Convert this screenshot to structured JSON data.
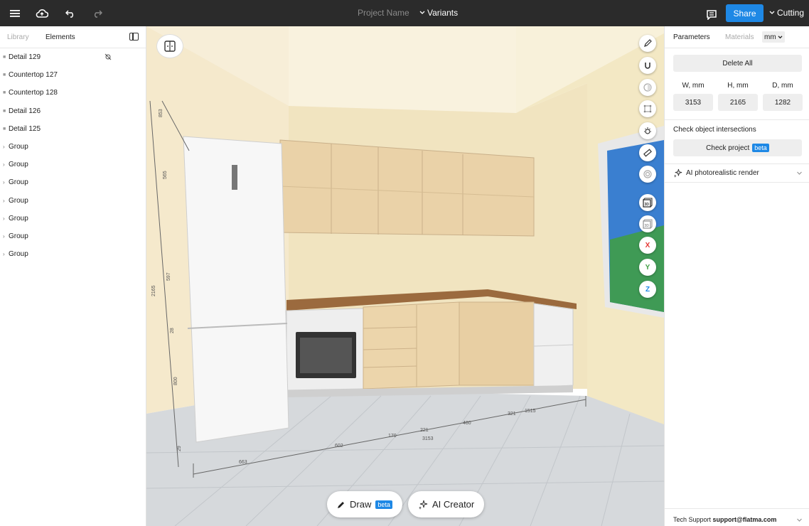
{
  "topbar": {
    "project_name": "Project Name",
    "variants": "Variants",
    "share": "Share",
    "cutting": "Cutting"
  },
  "left_panel": {
    "tabs": [
      "Library",
      "Elements"
    ],
    "items": [
      {
        "label": "Detail 129",
        "kind": "leaf"
      },
      {
        "label": "Countertop 127",
        "kind": "leaf"
      },
      {
        "label": "Countertop 128",
        "kind": "leaf"
      },
      {
        "label": "Detail 126",
        "kind": "leaf"
      },
      {
        "label": "Detail 125",
        "kind": "leaf"
      },
      {
        "label": "Group",
        "kind": "group"
      },
      {
        "label": "Group",
        "kind": "group"
      },
      {
        "label": "Group",
        "kind": "group"
      },
      {
        "label": "Group",
        "kind": "group"
      },
      {
        "label": "Group",
        "kind": "group"
      },
      {
        "label": "Group",
        "kind": "group"
      },
      {
        "label": "Group",
        "kind": "group"
      }
    ]
  },
  "viewport": {
    "tools": [
      "pencil-icon",
      "magnet-icon",
      "contrast-icon",
      "bounding-box-icon",
      "light-icon",
      "ruler-icon",
      "target-icon",
      "view-3d-icon",
      "view-3d-alt-icon",
      "x-axis",
      "y-axis",
      "z-axis"
    ],
    "axis_labels": {
      "x": "X",
      "y": "Y",
      "z": "Z"
    },
    "axis_colors": {
      "x": "#e53935",
      "y": "#43a047",
      "z": "#1e88e5"
    },
    "draw_label": "Draw",
    "draw_badge": "beta",
    "ai_creator_label": "AI Creator",
    "dimensions": {
      "fridge_height": "2165",
      "d1": "853",
      "d2": "565",
      "d3": "597",
      "d4": "28",
      "d5": "800",
      "d6": "29",
      "floor_total": "3153",
      "f1": "663",
      "f2": "602",
      "f3": "170",
      "f4": "221",
      "f5": "480",
      "f6": "321",
      "f7": "1515"
    }
  },
  "right_panel": {
    "tabs": [
      "Parameters",
      "Materials"
    ],
    "unit": "mm",
    "delete_all": "Delete All",
    "dims": [
      {
        "label": "W, mm",
        "value": "3153"
      },
      {
        "label": "H, mm",
        "value": "2165"
      },
      {
        "label": "D, mm",
        "value": "1282"
      }
    ],
    "intersections_label": "Check object intersections",
    "check_project": "Check project",
    "check_badge": "beta",
    "ai_render": "AI photorealistic render",
    "tech_support_label": "Tech Support",
    "tech_support_email": "support@flatma.com"
  }
}
